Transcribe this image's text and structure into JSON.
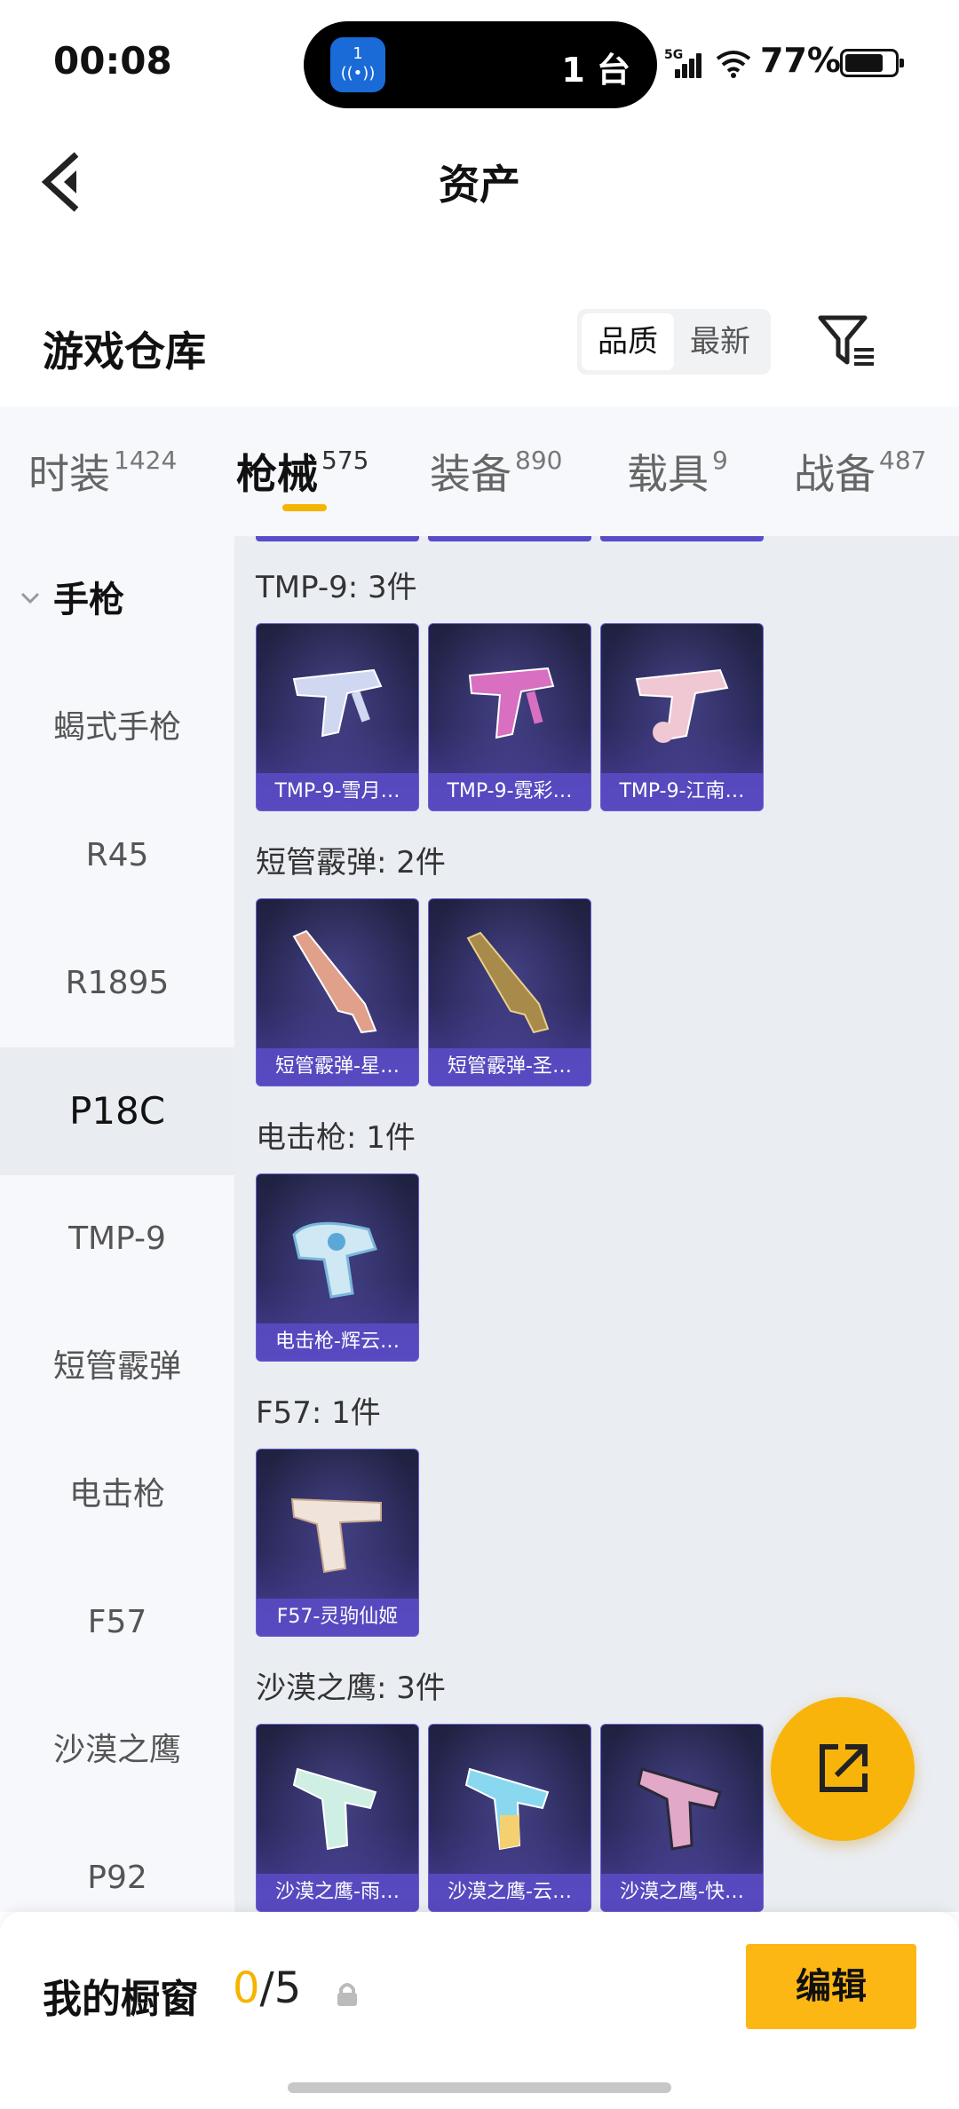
{
  "status_bar": {
    "time": "00:08",
    "island_app_badge": "1",
    "island_text": "1 台",
    "network": "5G",
    "battery": "77%"
  },
  "nav": {
    "title": "资产"
  },
  "warehouse": {
    "title": "游戏仓库",
    "sort_options": [
      "品质",
      "最新"
    ],
    "active_sort": "品质"
  },
  "tabs": [
    {
      "label": "时装",
      "count": "1424"
    },
    {
      "label": "枪械",
      "count": "575"
    },
    {
      "label": "装备",
      "count": "890"
    },
    {
      "label": "载具",
      "count": "9"
    },
    {
      "label": "战备",
      "count": "487"
    }
  ],
  "sidebar": {
    "group": "手枪",
    "items": [
      "蝎式手枪",
      "R45",
      "R1895",
      "P18C",
      "TMP-9",
      "短管霰弹",
      "电击枪",
      "F57",
      "沙漠之鹰",
      "P92"
    ],
    "active": "P18C"
  },
  "groups": [
    {
      "label": "TMP-9: 3件",
      "items": [
        "TMP-9-雪月…",
        "TMP-9-霓彩…",
        "TMP-9-江南…"
      ]
    },
    {
      "label": "短管霰弹: 2件",
      "items": [
        "短管霰弹-星…",
        "短管霰弹-圣…"
      ]
    },
    {
      "label": "电击枪: 1件",
      "items": [
        "电击枪-辉云…"
      ]
    },
    {
      "label": "F57: 1件",
      "items": [
        "F57-灵驹仙姬"
      ]
    },
    {
      "label": "沙漠之鹰: 3件",
      "items": [
        "沙漠之鹰-雨…",
        "沙漠之鹰-云…",
        "沙漠之鹰-快…"
      ]
    }
  ],
  "gun_colors": {
    "tmp_1": "#cfd8f0",
    "tmp_2": "#d86fc0",
    "tmp_3": "#f0c8d4",
    "sg_1": "#e0a08a",
    "sg_2": "#a88a4a",
    "stun_1": "#cfe8f4",
    "f57_1": "#f0e4da",
    "de_1": "#cfeee4",
    "de_2": "#f4d070",
    "de_3": "#e2a8c8"
  },
  "showcase": {
    "title": "我的橱窗",
    "current": "0",
    "separator": "/",
    "max": "5",
    "edit_label": "编辑"
  },
  "accent_color": "#f5b400"
}
